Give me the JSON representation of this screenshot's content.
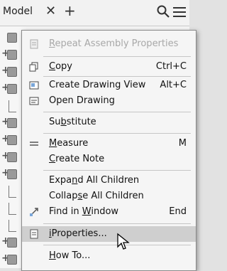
{
  "browser": {
    "tab_title": "Model",
    "close_glyph": "✕",
    "add_glyph": "+",
    "search_icon": "search-icon",
    "menu_icon": "hamburger-icon"
  },
  "menu": {
    "items": [
      {
        "pre": "",
        "u": "R",
        "post": "epeat Assembly Properties",
        "shortcut": "",
        "icon": "properties-icon",
        "disabled": true
      },
      {
        "pre": "",
        "u": "C",
        "post": "opy",
        "shortcut": "Ctrl+C",
        "icon": "copy-icon",
        "disabled": false
      },
      {
        "pre": "Create Drawing View",
        "u": "",
        "post": "",
        "shortcut": "Alt+C",
        "icon": "drawing-view-icon",
        "disabled": false
      },
      {
        "pre": "",
        "u": "",
        "post": "Open Drawing",
        "shortcut": "",
        "icon": "open-drawing-icon",
        "disabled": false
      },
      {
        "pre": "Su",
        "u": "b",
        "post": "stitute",
        "shortcut": "",
        "icon": "",
        "disabled": false
      },
      {
        "pre": "",
        "u": "M",
        "post": "easure",
        "shortcut": "M",
        "icon": "measure-icon",
        "disabled": false
      },
      {
        "pre": "",
        "u": "C",
        "post": "reate Note",
        "shortcut": "",
        "icon": "",
        "disabled": false
      },
      {
        "pre": "Expa",
        "u": "n",
        "post": "d All Children",
        "shortcut": "",
        "icon": "",
        "disabled": false
      },
      {
        "pre": "Collap",
        "u": "s",
        "post": "e All Children",
        "shortcut": "",
        "icon": "",
        "disabled": false
      },
      {
        "pre": "Find in ",
        "u": "W",
        "post": "indow",
        "shortcut": "End",
        "icon": "find-in-window-icon",
        "disabled": false
      },
      {
        "pre": "",
        "u": "i",
        "post": "Properties...",
        "shortcut": "",
        "icon": "iproperties-icon",
        "disabled": false
      },
      {
        "pre": "",
        "u": "H",
        "post": "ow To...",
        "shortcut": "",
        "icon": "",
        "disabled": false
      }
    ]
  },
  "colors": {
    "menu_bg": "#f5f5f5",
    "highlight": "#cfcfcf",
    "disabled_text": "#a8a8a8"
  }
}
